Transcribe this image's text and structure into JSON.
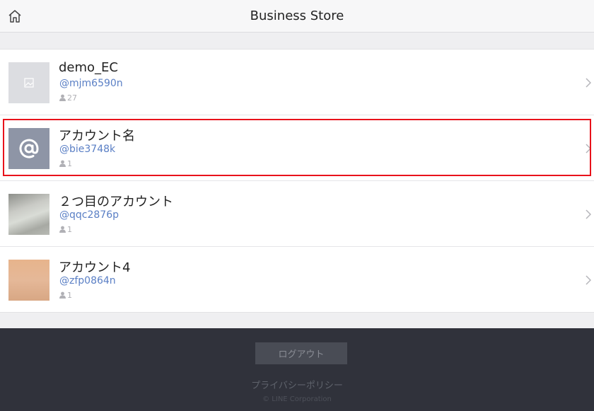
{
  "header": {
    "title": "Business Store",
    "home_icon": "home-icon"
  },
  "accounts": [
    {
      "name": "demo_EC",
      "handle": "@mjm6590n",
      "followers": "27",
      "thumb": "image-placeholder-icon"
    },
    {
      "name": "アカウント名",
      "handle": "@bie3748k",
      "followers": "1",
      "thumb": "at-sign-icon",
      "highlighted": true
    },
    {
      "name": "２つ目のアカウント",
      "handle": "@qqc2876p",
      "followers": "1",
      "thumb": "photo"
    },
    {
      "name": "アカウント4",
      "handle": "@zfp0864n",
      "followers": "1",
      "thumb": "photo"
    }
  ],
  "footer": {
    "logout_label": "ログアウト",
    "privacy_label": "プライバシーポリシー",
    "copyright": "© LINE Corporation"
  },
  "colors": {
    "highlight": "#e8121b",
    "handle": "#5a7fc5",
    "footer_bg": "#30323b"
  }
}
